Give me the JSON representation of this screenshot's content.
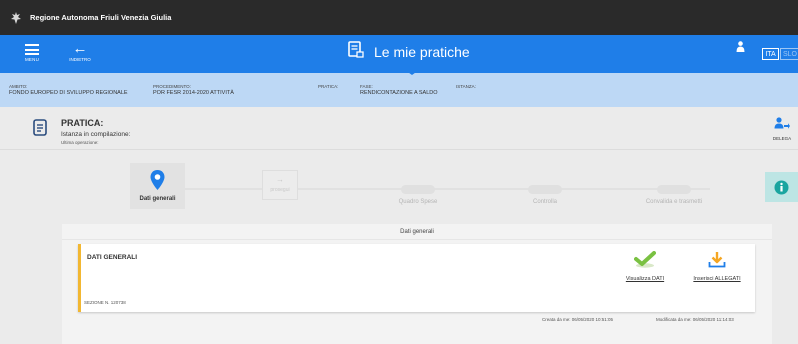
{
  "region": {
    "name": "Regione Autonoma Friuli Venezia Giulia"
  },
  "header": {
    "menu_label": "MENU",
    "back_label": "INDIETRO",
    "title": "Le mie pratiche",
    "lang_ita": "ITA",
    "lang_slo": "SLO"
  },
  "info_bar": {
    "ambito_label": "AMBITO:",
    "ambito_value": "FONDO EUROPEO DI SVILUPPO REGIONALE",
    "procedimento_label": "PROCEDIMENTO:",
    "procedimento_value": "POR FESR 2014-2020 ATTIVITÀ",
    "pratica_label": "PRATICA:",
    "pratica_value": "",
    "fase_label": "FASE:",
    "fase_value": "RENDICONTAZIONE A SALDO",
    "istanza_label": "ISTANZA:",
    "istanza_value": ""
  },
  "pratica": {
    "title": "PRATICA:",
    "status": "Istanza in compilazione:",
    "last_op": "Ultima operazione:",
    "delega_label": "DELEGA"
  },
  "stepper": {
    "steps": [
      {
        "label": "Dati generali",
        "active": true
      },
      {
        "label": "Quadro Spese",
        "active": false
      },
      {
        "label": "Controlla",
        "active": false
      },
      {
        "label": "Convalida e trasmetti",
        "active": false
      }
    ],
    "prosegui_label": "prosegui"
  },
  "panel": {
    "title": "Dati generali",
    "card_title": "DATI GENERALI",
    "sezione": "SEZIONE N. 120738",
    "action_view": "Visualizza DATI",
    "action_attach": "Inserisci ALLEGATI",
    "created": "Creata da me: 06/05/2020 10:51:05",
    "modified": "Modificata da me: 06/05/2020 11:14:03"
  },
  "colors": {
    "header_blue": "#1f7ee8",
    "info_bar": "#bdd8f5",
    "card_accent": "#f2b732",
    "marker_blue": "#1f7ee8",
    "check_green": "#7ac142",
    "download_orange": "#f5a623",
    "info_teal": "#bde5e4"
  }
}
